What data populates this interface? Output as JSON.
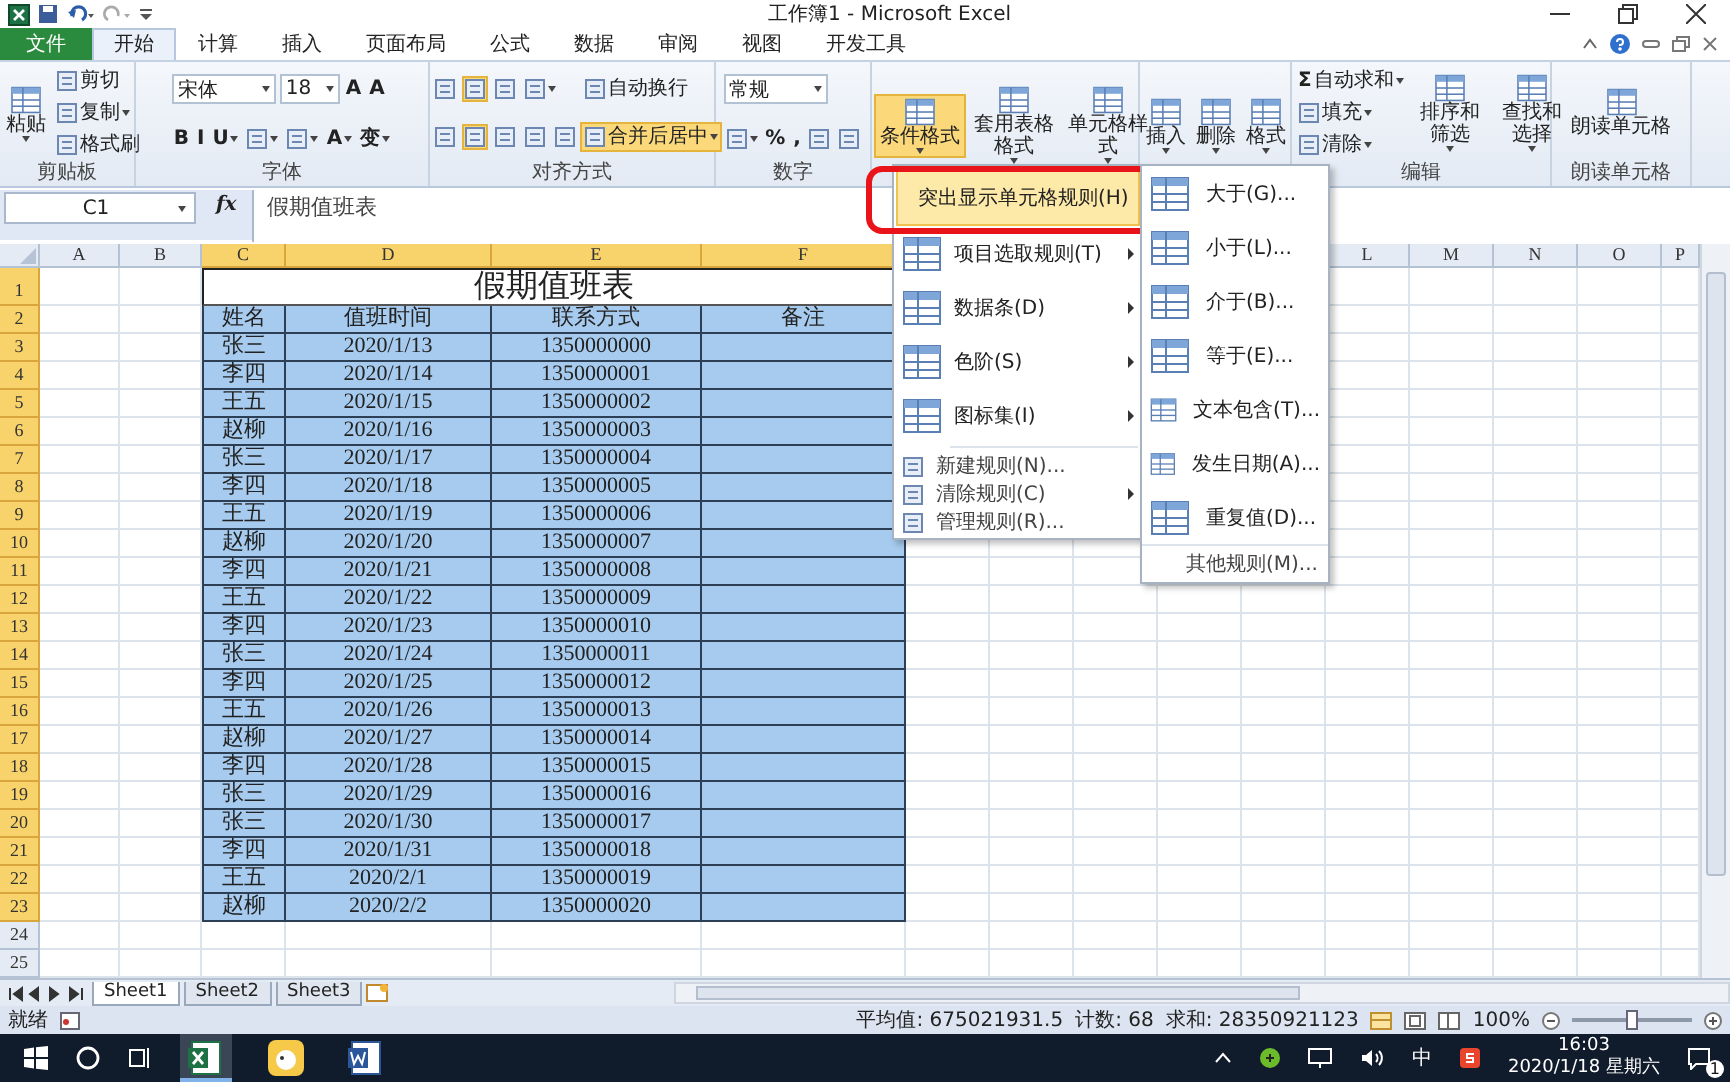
{
  "title_bar": {
    "title": "工作簿1 - Microsoft Excel"
  },
  "tabs": [
    {
      "label": "文件",
      "kind": "file",
      "selected": false
    },
    {
      "label": "开始",
      "kind": "tab",
      "selected": true
    },
    {
      "label": "计算",
      "kind": "tab",
      "selected": false
    },
    {
      "label": "插入",
      "kind": "tab",
      "selected": false
    },
    {
      "label": "页面布局",
      "kind": "tab",
      "selected": false
    },
    {
      "label": "公式",
      "kind": "tab",
      "selected": false
    },
    {
      "label": "数据",
      "kind": "tab",
      "selected": false
    },
    {
      "label": "审阅",
      "kind": "tab",
      "selected": false
    },
    {
      "label": "视图",
      "kind": "tab",
      "selected": false
    },
    {
      "label": "开发工具",
      "kind": "tab",
      "selected": false
    }
  ],
  "ribbon": {
    "groups": [
      {
        "label": "剪贴板",
        "columns": [
          [
            [
              {
                "kind": "big",
                "label": "粘贴",
                "dropdown": true,
                "selected": false
              }
            ]
          ],
          [
            [
              {
                "kind": "small",
                "label": "剪切",
                "selected": false
              }
            ],
            [
              {
                "kind": "small",
                "label": "复制",
                "dropdown": true,
                "selected": false
              }
            ],
            [
              {
                "kind": "small",
                "label": "格式刷",
                "selected": false
              }
            ]
          ]
        ]
      },
      {
        "label": "字体",
        "columns": [
          [
            [
              {
                "kind": "field",
                "value": "宋体",
                "wide": true
              },
              {
                "kind": "field",
                "value": "18",
                "wide": false
              },
              {
                "kind": "glyph",
                "label": "A",
                "selected": false
              },
              {
                "kind": "glyph",
                "label": "A",
                "selected": false
              }
            ],
            [
              {
                "kind": "glyph",
                "label": "B",
                "selected": false
              },
              {
                "kind": "glyph",
                "label": "I",
                "selected": false
              },
              {
                "kind": "glyph",
                "label": "U",
                "dropdown": true,
                "selected": false
              },
              {
                "kind": "icon",
                "dropdown": true,
                "selected": false
              },
              {
                "kind": "icon",
                "dropdown": true,
                "selected": false
              },
              {
                "kind": "glyph",
                "label": "A",
                "dropdown": true,
                "selected": false
              },
              {
                "kind": "glyph",
                "label": "变",
                "dropdown": true,
                "selected": false
              }
            ]
          ]
        ]
      },
      {
        "label": "对齐方式",
        "columns": [
          [
            [
              {
                "kind": "icon",
                "selected": false
              },
              {
                "kind": "icon",
                "selected": true
              },
              {
                "kind": "icon",
                "selected": false
              },
              {
                "kind": "icon",
                "dropdown": true,
                "selected": false
              }
            ],
            [
              {
                "kind": "icon",
                "selected": false
              },
              {
                "kind": "icon",
                "selected": true
              },
              {
                "kind": "icon",
                "selected": false
              },
              {
                "kind": "icon",
                "selected": false
              },
              {
                "kind": "icon",
                "selected": false
              }
            ]
          ],
          [
            [
              {
                "kind": "small",
                "label": "自动换行",
                "selected": false
              }
            ],
            [
              {
                "kind": "small",
                "label": "合并后居中",
                "dropdown": true,
                "selected": true
              }
            ]
          ]
        ]
      },
      {
        "label": "数字",
        "columns": [
          [
            [
              {
                "kind": "field",
                "value": "常规",
                "wide": true
              }
            ],
            [
              {
                "kind": "icon",
                "dropdown": true,
                "selected": false
              },
              {
                "kind": "glyph",
                "label": "%",
                "selected": false
              },
              {
                "kind": "glyph",
                "label": ",",
                "selected": false
              },
              {
                "kind": "icon",
                "selected": false
              },
              {
                "kind": "icon",
                "selected": false
              }
            ]
          ]
        ]
      },
      {
        "columns": [
          [
            [
              {
                "kind": "big",
                "label": "条件格式",
                "dropdown": true,
                "selected": true
              }
            ]
          ],
          [
            [
              {
                "kind": "big",
                "label": "套用表格格式",
                "dropdown": true,
                "selected": false
              }
            ]
          ],
          [
            [
              {
                "kind": "big",
                "label": "单元格样式",
                "dropdown": true,
                "selected": false
              }
            ]
          ]
        ]
      },
      {
        "columns": [
          [
            [
              {
                "kind": "big",
                "label": "插入",
                "dropdown": true,
                "selected": false
              }
            ]
          ],
          [
            [
              {
                "kind": "big",
                "label": "删除",
                "dropdown": true,
                "selected": false
              }
            ]
          ],
          [
            [
              {
                "kind": "big",
                "label": "格式",
                "dropdown": true,
                "selected": false
              }
            ]
          ]
        ]
      },
      {
        "label": "编辑",
        "columns": [
          [
            [
              {
                "kind": "small",
                "glyph": "Σ",
                "label": "自动求和",
                "dropdown": true,
                "selected": false
              }
            ],
            [
              {
                "kind": "small",
                "label": "填充",
                "dropdown": true,
                "selected": false
              }
            ],
            [
              {
                "kind": "small",
                "label": "清除",
                "dropdown": true,
                "selected": false
              }
            ]
          ],
          [
            [
              {
                "kind": "big",
                "label": "排序和筛选",
                "dropdown": true,
                "selected": false
              }
            ]
          ],
          [
            [
              {
                "kind": "big",
                "label": "查找和选择",
                "dropdown": true,
                "selected": false
              }
            ]
          ]
        ]
      },
      {
        "label": "朗读单元格",
        "columns": [
          [
            [
              {
                "kind": "big",
                "label": "朗读单元格",
                "selected": false
              }
            ]
          ]
        ]
      }
    ]
  },
  "formula_bar": {
    "name_box": "C1",
    "function_label": "fx",
    "content": "假期值班表"
  },
  "sheet": {
    "columns": [
      {
        "label": "A",
        "selected": false
      },
      {
        "label": "B",
        "selected": false
      },
      {
        "label": "C",
        "selected": true
      },
      {
        "label": "D",
        "selected": true
      },
      {
        "label": "E",
        "selected": true
      },
      {
        "label": "F",
        "selected": true
      },
      {},
      {},
      {},
      {},
      {},
      {
        "label": "L",
        "selected": false
      },
      {
        "label": "M",
        "selected": false
      },
      {
        "label": "N",
        "selected": false
      },
      {
        "label": "O",
        "selected": false
      },
      {
        "label": "P",
        "selected": false
      }
    ],
    "rows": [
      {
        "number": "1",
        "kind": "title",
        "selected": true,
        "cells": [
          "假期值班表"
        ]
      },
      {
        "number": "2",
        "kind": "header",
        "selected": true,
        "cells": [
          "姓名",
          "值班时间",
          "联系方式",
          "备注"
        ]
      },
      {
        "number": "3",
        "kind": "data",
        "selected": true,
        "cells": [
          "张三",
          "2020/1/13",
          "1350000000"
        ]
      },
      {
        "number": "4",
        "kind": "data",
        "selected": true,
        "cells": [
          "李四",
          "2020/1/14",
          "1350000001"
        ]
      },
      {
        "number": "5",
        "kind": "data",
        "selected": true,
        "cells": [
          "王五",
          "2020/1/15",
          "1350000002"
        ]
      },
      {
        "number": "6",
        "kind": "data",
        "selected": true,
        "cells": [
          "赵柳",
          "2020/1/16",
          "1350000003"
        ]
      },
      {
        "number": "7",
        "kind": "data",
        "selected": true,
        "cells": [
          "张三",
          "2020/1/17",
          "1350000004"
        ]
      },
      {
        "number": "8",
        "kind": "data",
        "selected": true,
        "cells": [
          "李四",
          "2020/1/18",
          "1350000005"
        ]
      },
      {
        "number": "9",
        "kind": "data",
        "selected": true,
        "cells": [
          "王五",
          "2020/1/19",
          "1350000006"
        ]
      },
      {
        "number": "10",
        "kind": "data",
        "selected": true,
        "cells": [
          "赵柳",
          "2020/1/20",
          "1350000007"
        ]
      },
      {
        "number": "11",
        "kind": "data",
        "selected": true,
        "cells": [
          "李四",
          "2020/1/21",
          "1350000008"
        ]
      },
      {
        "number": "12",
        "kind": "data",
        "selected": true,
        "cells": [
          "王五",
          "2020/1/22",
          "1350000009"
        ]
      },
      {
        "number": "13",
        "kind": "data",
        "selected": true,
        "cells": [
          "李四",
          "2020/1/23",
          "1350000010"
        ]
      },
      {
        "number": "14",
        "kind": "data",
        "selected": true,
        "cells": [
          "张三",
          "2020/1/24",
          "1350000011"
        ]
      },
      {
        "number": "15",
        "kind": "data",
        "selected": true,
        "cells": [
          "李四",
          "2020/1/25",
          "1350000012"
        ]
      },
      {
        "number": "16",
        "kind": "data",
        "selected": true,
        "cells": [
          "王五",
          "2020/1/26",
          "1350000013"
        ]
      },
      {
        "number": "17",
        "kind": "data",
        "selected": true,
        "cells": [
          "赵柳",
          "2020/1/27",
          "1350000014"
        ]
      },
      {
        "number": "18",
        "kind": "data",
        "selected": true,
        "cells": [
          "李四",
          "2020/1/28",
          "1350000015"
        ]
      },
      {
        "number": "19",
        "kind": "data",
        "selected": true,
        "cells": [
          "张三",
          "2020/1/29",
          "1350000016"
        ]
      },
      {
        "number": "20",
        "kind": "data",
        "selected": true,
        "cells": [
          "张三",
          "2020/1/30",
          "1350000017"
        ]
      },
      {
        "number": "21",
        "kind": "data",
        "selected": true,
        "cells": [
          "李四",
          "2020/1/31",
          "1350000018"
        ]
      },
      {
        "number": "22",
        "kind": "data",
        "selected": true,
        "cells": [
          "王五",
          "2020/2/1",
          "1350000019"
        ]
      },
      {
        "number": "23",
        "kind": "data",
        "selected": true,
        "cells": [
          "赵柳",
          "2020/2/2",
          "1350000020"
        ]
      },
      {
        "number": "24",
        "kind": "empty",
        "selected": false
      },
      {
        "number": "25",
        "kind": "empty",
        "selected": false
      }
    ]
  },
  "menu": {
    "items": [
      {
        "kind": "large",
        "label": "突出显示单元格规则(H)",
        "submenu": true,
        "selected": true,
        "callout": true
      },
      {
        "kind": "large",
        "label": "项目选取规则(T)",
        "submenu": true,
        "selected": false,
        "callout": false
      },
      {
        "kind": "large",
        "label": "数据条(D)",
        "submenu": true,
        "selected": false,
        "callout": false
      },
      {
        "kind": "large",
        "label": "色阶(S)",
        "submenu": true,
        "selected": false,
        "callout": false
      },
      {
        "kind": "large",
        "label": "图标集(I)",
        "submenu": true,
        "selected": false,
        "callout": false
      },
      {
        "kind": "small",
        "label": "新建规则(N)...",
        "submenu": false,
        "selected": false,
        "callout": false
      },
      {
        "kind": "small",
        "label": "清除规则(C)",
        "submenu": true,
        "selected": false,
        "callout": false
      },
      {
        "kind": "small",
        "label": "管理规则(R)...",
        "submenu": false,
        "selected": false,
        "callout": false
      }
    ],
    "submenu": {
      "items": [
        {
          "label": "大于(G)..."
        },
        {
          "label": "小于(L)..."
        },
        {
          "label": "介于(B)..."
        },
        {
          "label": "等于(E)..."
        },
        {
          "label": "文本包含(T)..."
        },
        {
          "label": "发生日期(A)..."
        },
        {
          "label": "重复值(D)..."
        }
      ],
      "footer": "其他规则(M)..."
    }
  },
  "sheet_tabs": [
    {
      "label": "Sheet1",
      "selected": true
    },
    {
      "label": "Sheet2",
      "selected": false
    },
    {
      "label": "Sheet3",
      "selected": false
    }
  ],
  "status_bar": {
    "mode": "就绪",
    "average": "平均值: 675021931.5",
    "count": "计数: 68",
    "sum": "求和: 28350921123",
    "zoom": "100%",
    "level": 0.5
  },
  "taskbar": {
    "apps": [
      {
        "kind": "excel",
        "selected": true
      },
      {
        "kind": "app",
        "selected": false
      },
      {
        "kind": "word",
        "selected": false
      }
    ],
    "ime": "中",
    "time": "16:03",
    "date": "2020/1/18 星期六",
    "notifications": "1"
  }
}
